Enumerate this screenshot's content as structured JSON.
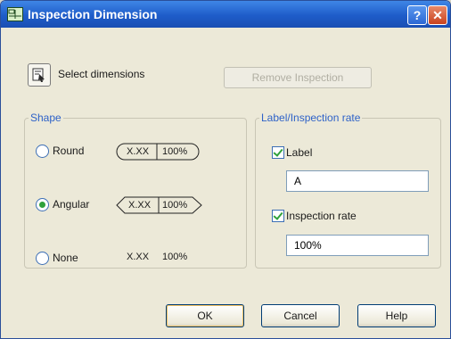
{
  "title": "Inspection Dimension",
  "titlebar": {
    "help_symbol": "?",
    "close_symbol": "✕"
  },
  "toolbar": {
    "select_label": "Select dimensions",
    "remove_label": "Remove Inspection",
    "remove_enabled": false
  },
  "shape": {
    "legend": "Shape",
    "options": [
      {
        "label": "Round",
        "selected": false,
        "sample_value": "X.XX",
        "sample_rate": "100%",
        "sample_style": "rounded"
      },
      {
        "label": "Angular",
        "selected": true,
        "sample_value": "X.XX",
        "sample_rate": "100%",
        "sample_style": "angular"
      },
      {
        "label": "None",
        "selected": false,
        "sample_value": "X.XX",
        "sample_rate": "100%",
        "sample_style": "none"
      }
    ]
  },
  "label_group": {
    "legend": "Label/Inspection rate",
    "label": {
      "checkbox_label": "Label",
      "checked": true,
      "value": "A"
    },
    "rate": {
      "checkbox_label": "Inspection rate",
      "checked": true,
      "value": "100%"
    }
  },
  "buttons": {
    "ok": "OK",
    "cancel": "Cancel",
    "help": "Help"
  },
  "colors": {
    "titlebar": "#1e5cc9",
    "legend": "#2e62c8",
    "radio_dot": "#2fa13a",
    "close": "#c9421e"
  },
  "icons": [
    "app-icon",
    "help-icon",
    "close-icon",
    "select-dimensions-icon"
  ]
}
